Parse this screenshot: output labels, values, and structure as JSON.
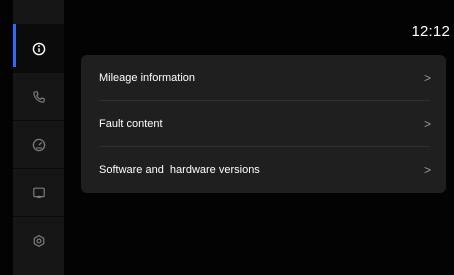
{
  "status_bar": {
    "time": "12:12"
  },
  "sidebar": {
    "items": [
      {
        "icon": "info-icon",
        "active": true
      },
      {
        "icon": "phone-icon",
        "active": false
      },
      {
        "icon": "gauge-icon",
        "active": false
      },
      {
        "icon": "screen-cast-icon",
        "active": false
      },
      {
        "icon": "settings-gear-icon",
        "active": false
      }
    ],
    "accent_color": "#2b6cff"
  },
  "menu": {
    "items": [
      {
        "label": "Mileage information",
        "chevron": ">"
      },
      {
        "label": "Fault content",
        "chevron": ">"
      },
      {
        "label": "Software and  hardware versions",
        "chevron": ">"
      }
    ]
  }
}
